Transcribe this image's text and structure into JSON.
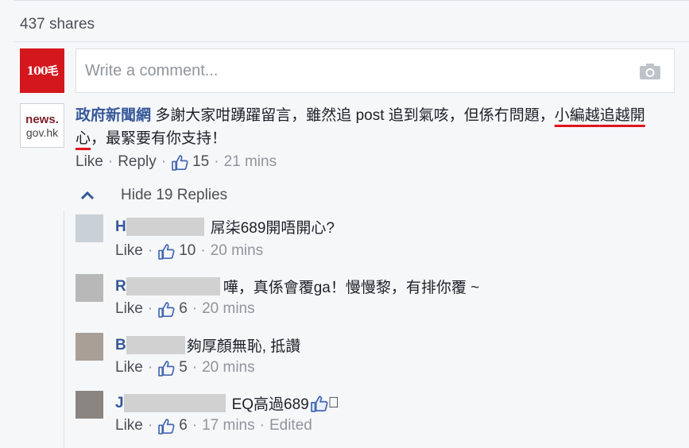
{
  "post": {
    "shares": "437 shares"
  },
  "composer": {
    "avatar_text": "100毛",
    "placeholder": "Write a comment..."
  },
  "comment": {
    "avatar_line1": "news.",
    "avatar_line2": "gov.hk",
    "author": "政府新聞網",
    "text_before": "多謝大家咁踴躍留言，雖然追 post 追到氣咳，但係冇問題，",
    "highlight_1": "小編越",
    "highlight_2": "追越開心",
    "text_after": "，最緊要有你支持！",
    "like": "Like",
    "reply": "Reply",
    "likes": "15",
    "time": "21 mins",
    "hide_replies": "Hide 19 Replies"
  },
  "replies": [
    {
      "initial": "H",
      "text": "屌柒689開唔開心?",
      "like": "Like",
      "likes": "10",
      "time": "20 mins"
    },
    {
      "initial": "R",
      "text": "嘩，真係會覆ga！慢慢黎，有排你覆 ~",
      "like": "Like",
      "likes": "6",
      "time": "20 mins"
    },
    {
      "initial": "B",
      "text": "夠厚顏無恥, 抵讚",
      "like": "Like",
      "likes": "5",
      "time": "20 mins"
    },
    {
      "initial": "J",
      "text": "EQ高過689",
      "trail": "􏿾",
      "like": "Like",
      "likes": "6",
      "time": "17 mins",
      "edited": "Edited"
    }
  ],
  "colors": {
    "link": "#365899",
    "muted": "#90949c",
    "highlight_underline": "#e0141d",
    "brand_red": "#d4171d"
  }
}
